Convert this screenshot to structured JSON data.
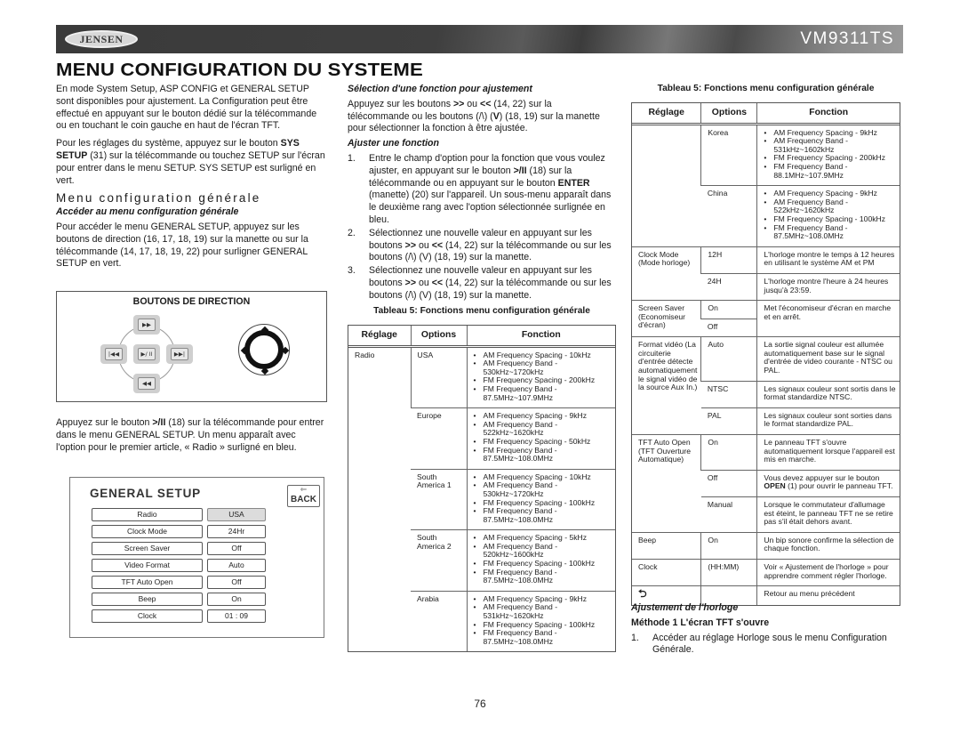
{
  "header": {
    "brand": "JENSEN",
    "model": "VM9311TS"
  },
  "page_title": "MENU CONFIGURATION DU SYSTEME",
  "col1": {
    "p1": "En mode System Setup, ASP CONFIG et GENERAL SETUP sont disponibles pour ajustement. La Configuration peut être effectué en appuyant sur le bouton dédié sur la télécommande ou en touchant le coin gauche en haut de l'écran TFT.",
    "p2_pre": "Pour les réglages du système, appuyez sur le bouton ",
    "p2_bold": "SYS SETUP",
    "p2_post": " (31) sur la télécommande ou touchez SETUP sur l'écran pour entrer dans le menu SETUP. SYS SETUP est surligné en vert.",
    "section_heading": "Menu configuration générale",
    "sub_heading": "Accéder au menu configuration générale",
    "p3": "Pour accéder le menu GENERAL SETUP, appuyez sur les boutons de direction (16, 17, 18, 19) sur la manette ou sur la télécommande (14, 17, 18, 19, 22) pour surligner GENERAL SETUP en vert.",
    "direction_box": {
      "title": "BOUTONS DE DIRECTION",
      "buttons": {
        "up": "▶▶",
        "left": "|◀◀",
        "center": "▶/ II",
        "right": "▶▶|",
        "down": "◀◀"
      }
    },
    "p4_pre": "Appuyez sur le bouton ",
    "p4_bold": ">/II",
    "p4_post": " (18) sur la télécommande pour entrer dans le menu GENERAL SETUP. Un menu apparaît avec l'option pour le premier article, « Radio » surligné en bleu.",
    "general_setup": {
      "title": "GENERAL SETUP",
      "back_arrow": "⇐",
      "back_label": "BACK",
      "rows": [
        {
          "label": "Radio",
          "value": "USA",
          "selected": true
        },
        {
          "label": "Clock  Mode",
          "value": "24Hr"
        },
        {
          "label": "Screen Saver",
          "value": "Off"
        },
        {
          "label": "Video Format",
          "value": "Auto"
        },
        {
          "label": "TFT Auto Open",
          "value": "Off"
        },
        {
          "label": "Beep",
          "value": "On"
        },
        {
          "label": "Clock",
          "value": "01  :  09"
        }
      ]
    }
  },
  "col2": {
    "sub1": "Sélection d'une fonction pour ajustement",
    "p1_a": "Appuyez sur les boutons ",
    "p1_b1": ">>",
    "p1_c": " ou ",
    "p1_b2": "<<",
    "p1_d": " (14, 22) sur la télécommande ou les boutons (/\\) (",
    "p1_b3": "V",
    "p1_e": ") (18, 19) sur la manette pour sélectionner la fonction à être ajustée.",
    "sub2": "Ajuster une fonction",
    "steps": [
      {
        "num": "1.",
        "a": "Entre le champ d'option pour la fonction que vous voulez ajuster, en appuyant sur le bouton ",
        "b": ">/II",
        "c": " (18) sur la télécommande ou en appuyant sur le bouton ",
        "d": "ENTER",
        "e": " (manette) (20) sur l'appareil. Un sous-menu apparaît dans le deuxième rang avec l'option sélectionnée surlignée en bleu."
      },
      {
        "num": "2.",
        "a": "Sélectionnez une nouvelle valeur en appuyant sur les boutons ",
        "b": ">>",
        "c": " ou ",
        "d": "<<",
        "e": " (14, 22) sur la télécommande ou sur les boutons (/\\) (V) (18, 19) sur la manette."
      },
      {
        "num": "3.",
        "a": "Sélectionnez une nouvelle valeur en appuyant sur les boutons ",
        "b": ">>",
        "c": " ou ",
        "d": "<<",
        "e": " (14, 22) sur la télécommande ou sur les boutons (/\\) (V) (18, 19) sur la manette."
      }
    ]
  },
  "table": {
    "caption": "Tableau 5: Fonctions menu configuration générale",
    "headers": [
      "Réglage",
      "Options",
      "Fonction"
    ],
    "part1": {
      "setting": "Radio",
      "rows": [
        {
          "option": "USA",
          "items": [
            "AM Frequency Spacing - 10kHz",
            "AM Frequency Band - 530kHz~1720kHz",
            "FM Frequency Spacing - 200kHz",
            "FM Frequency Band - 87.5MHz~107.9MHz"
          ]
        },
        {
          "option": "Europe",
          "items": [
            "AM Frequency Spacing - 9kHz",
            "AM Frequency Band - 522kHz~1620kHz",
            "FM Frequency Spacing - 50kHz",
            "FM Frequency Band - 87.5MHz~108.0MHz"
          ]
        },
        {
          "option": "South America 1",
          "items": [
            "AM Frequency Spacing - 10kHz",
            "AM Frequency Band - 530kHz~1720kHz",
            "FM Frequency Spacing - 100kHz",
            "FM Frequency Band - 87.5MHz~108.0MHz"
          ]
        },
        {
          "option": "South America 2",
          "items": [
            "AM Frequency Spacing - 5kHz",
            "AM Frequency Band - 520kHz~1600kHz",
            "FM Frequency Spacing - 100kHz",
            "FM Frequency Band - 87.5MHz~108.0MHz"
          ]
        },
        {
          "option": "Arabia",
          "items": [
            "AM Frequency Spacing - 9kHz",
            "AM Frequency Band - 531kHz~1620kHz",
            "FM Frequency Spacing - 100kHz",
            "FM Frequency Band - 87.5MHz~108.0MHz"
          ]
        }
      ]
    },
    "part2": {
      "radio_rows": [
        {
          "option": "Korea",
          "items": [
            "AM Frequency Spacing - 9kHz",
            "AM Frequency Band - 531kHz~1602kHz",
            "FM Frequency Spacing - 200kHz",
            "FM Frequency Band - 88.1MHz~107.9MHz"
          ]
        },
        {
          "option": "China",
          "items": [
            "AM Frequency Spacing - 9kHz",
            "AM Frequency Band - 522kHz~1620kHz",
            "FM Frequency Spacing - 100kHz",
            "FM Frequency Band - 87.5MHz~108.0MHz"
          ]
        }
      ],
      "clock_mode": {
        "setting": "Clock Mode (Mode horloge)",
        "rows": [
          {
            "option": "12H",
            "text": "L'horloge montre le temps à 12 heures en utilisant le système AM et PM"
          },
          {
            "option": "24H",
            "text": "L'horloge montre l'heure à 24 heures jusqu'à 23:59."
          }
        ]
      },
      "screen_saver": {
        "setting": "Screen Saver (Economiseur d'écran)",
        "options": [
          "On",
          "Off"
        ],
        "text": "Met l'économiseur d'écran en marche et en arrêt."
      },
      "video_format": {
        "setting": "Format vidéo (La circuiterie d'entrée détecte automatiquement le signal vidéo de la source Aux In.)",
        "rows": [
          {
            "option": "Auto",
            "text": "La sortie signal couleur est allumée automatiquement base sur le signal d'entrée de video courante - NTSC ou PAL."
          },
          {
            "option": "NTSC",
            "text": "Les signaux couleur sont sortis dans le format standardize NTSC."
          },
          {
            "option": "PAL",
            "text": "Les signaux couleur sont sorties dans le format standardize PAL."
          }
        ]
      },
      "tft_auto": {
        "setting": "TFT Auto Open (TFT Ouverture Automatique)",
        "rows": [
          {
            "option": "On",
            "text_a": "Le panneau TFT s'ouvre automatiquement lorsque l'appareil est mis en marche.",
            "text_b": "",
            "text_c": ""
          },
          {
            "option": "Off",
            "text_a": "Vous devez appuyer sur le bouton ",
            "text_b": "OPEN",
            "text_c": " (1) pour ouvrir le panneau TFT."
          },
          {
            "option": "Manual",
            "text_a": "Lorsque le commutateur d'allumage est éteint, le panneau TFT ne se retire pas  s'il était dehors avant.",
            "text_b": "",
            "text_c": ""
          }
        ]
      },
      "beep": {
        "setting": "Beep",
        "option": "On",
        "text": "Un bip sonore confirme la sélection de chaque fonction."
      },
      "clock": {
        "setting": "Clock",
        "option": "(HH:MM)",
        "text": "Voir « Ajustement de l'horloge » pour apprendre comment régler l'horloge."
      },
      "return": {
        "icon": "⮌",
        "option": "",
        "text": "Retour au menu précédent"
      }
    }
  },
  "col3_bottom": {
    "sub1": "Ajustement de l'horloge",
    "sub2": "Méthode 1 L'écran TFT s'ouvre",
    "step_num": "1.",
    "step_text": "Accéder au réglage Horloge sous le menu Configuration Générale."
  },
  "page_number": "76"
}
